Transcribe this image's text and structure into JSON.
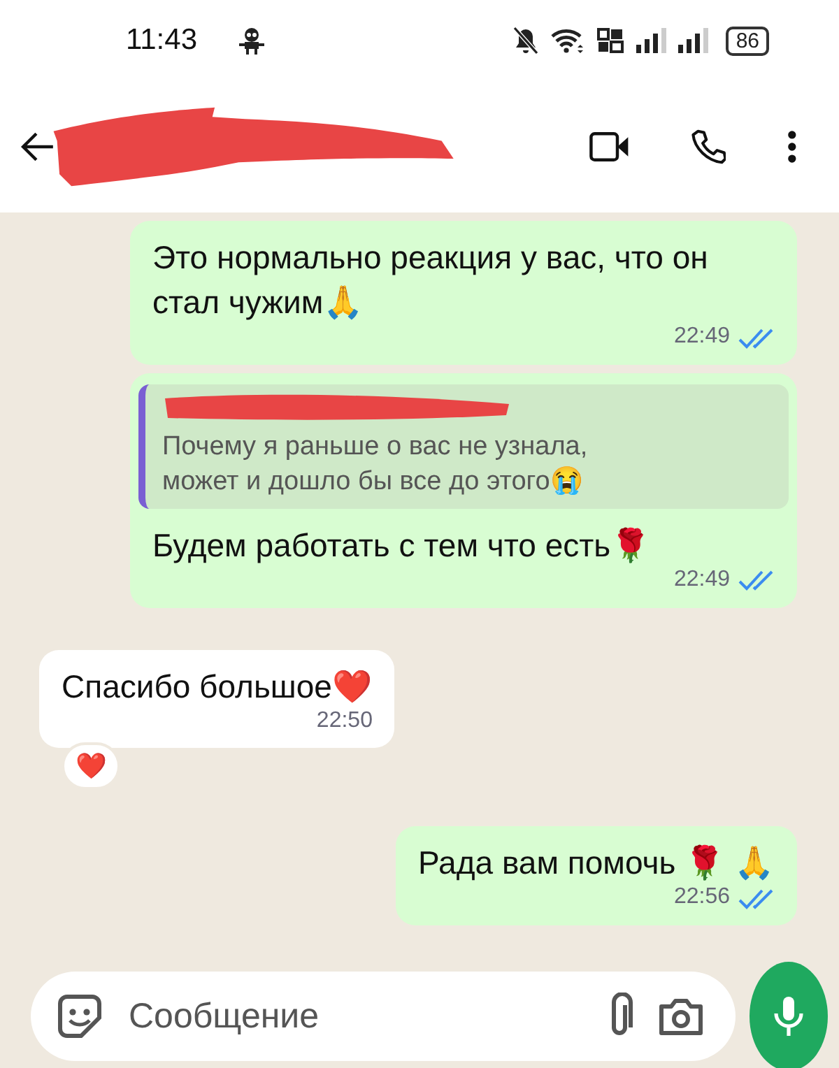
{
  "status_bar": {
    "time": "11:43",
    "battery": "86"
  },
  "header": {
    "contact_redacted": true
  },
  "messages": [
    {
      "kind": "outgoing",
      "text": "Это нормально реакция у вас, что он стал чужим🙏",
      "time": "22:49",
      "read": true
    },
    {
      "kind": "outgoing",
      "quote": {
        "author_redacted": true,
        "text": "Почему я раньше о вас не узнала, может и дошло бы все до этого😭"
      },
      "text": "Будем работать с тем что есть🌹",
      "time": "22:49",
      "read": true
    },
    {
      "kind": "incoming",
      "text": "Спасибо большое❤️",
      "time": "22:50",
      "reaction": "❤️"
    },
    {
      "kind": "outgoing",
      "text": "Рада вам помочь 🌹 🙏",
      "time": "22:56",
      "read": true
    }
  ],
  "composer": {
    "placeholder": "Сообщение"
  }
}
